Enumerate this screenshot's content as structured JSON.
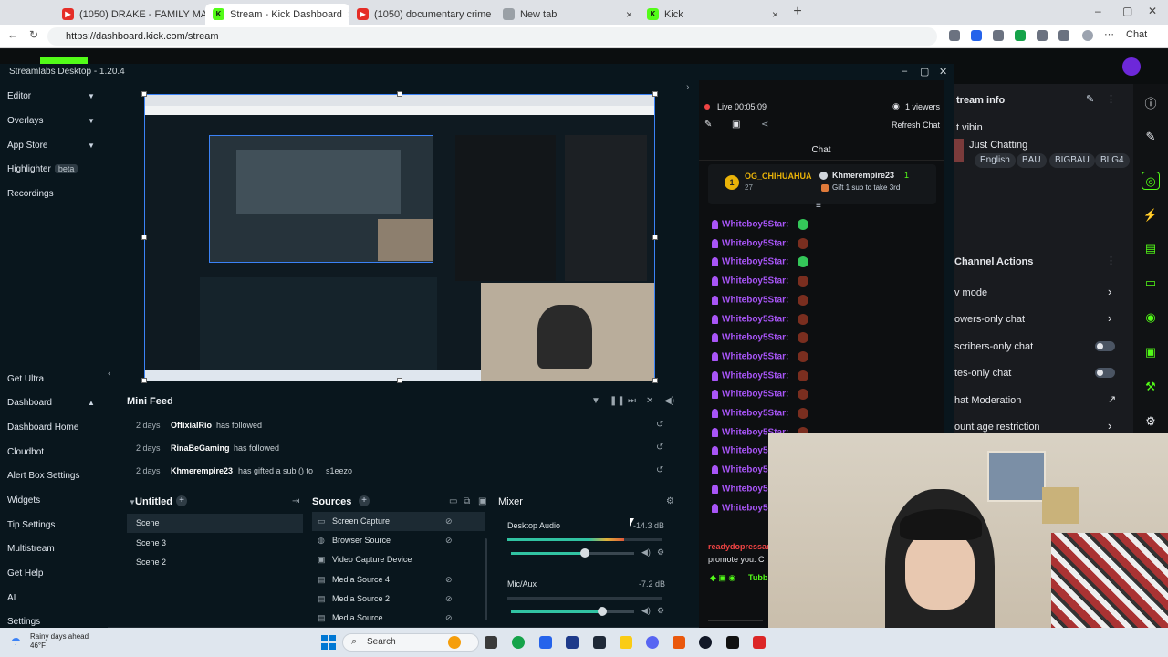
{
  "browser": {
    "tabs": [
      {
        "title": "(1050) DRAKE - FAMILY MATT",
        "icon": "youtube"
      },
      {
        "title": "Stream - Kick Dashboard",
        "icon": "kick"
      },
      {
        "title": "(1050) documentary crime - YouT",
        "icon": "youtube"
      },
      {
        "title": "New tab",
        "icon": "blank"
      },
      {
        "title": "Kick",
        "icon": "kick"
      }
    ],
    "url": "https://dashboard.kick.com/stream",
    "chat_button": "Chat"
  },
  "dashboard": {
    "stream_info_title": "tream info",
    "title_text": "t vibin",
    "category": "Just Chatting",
    "tags": [
      "English",
      "BAU",
      "BIGBAU",
      "BLG4"
    ],
    "channel_actions_title": "Channel Actions",
    "actions": [
      {
        "label": "v mode",
        "control": "chevron"
      },
      {
        "label": "owers-only chat",
        "control": "chevron"
      },
      {
        "label": "scribers-only chat",
        "control": "toggle"
      },
      {
        "label": "tes-only chat",
        "control": "toggle"
      },
      {
        "label": "hat Moderation",
        "control": "link"
      },
      {
        "label": "ount age restriction",
        "control": "chevron"
      }
    ]
  },
  "streamlabs": {
    "window_title": "Streamlabs Desktop - 1.20.4",
    "sidebar_top": [
      {
        "label": "Editor",
        "chevron": true
      },
      {
        "label": "Overlays",
        "chevron": true
      },
      {
        "label": "App Store",
        "chevron": true
      },
      {
        "label": "Highlighter",
        "badge": "beta"
      },
      {
        "label": "Recordings"
      }
    ],
    "sidebar_bottom": [
      {
        "label": "Get Ultra"
      },
      {
        "label": "Dashboard",
        "chevron": true
      },
      {
        "label": "Dashboard Home"
      },
      {
        "label": "Cloudbot"
      },
      {
        "label": "Alert Box Settings"
      },
      {
        "label": "Widgets"
      },
      {
        "label": "Tip Settings"
      },
      {
        "label": "Multistream"
      },
      {
        "label": "Get Help"
      },
      {
        "label": "AI"
      },
      {
        "label": "Settings"
      }
    ],
    "mini_feed": {
      "title": "Mini Feed",
      "rows": [
        {
          "when": "2 days",
          "who": "OffixialRio",
          "what": "has followed"
        },
        {
          "when": "2 days",
          "who": "RinaBeGaming",
          "what": "has followed"
        },
        {
          "when": "2 days",
          "who": "Khmerempire23",
          "what": "has gifted a sub () to",
          "target": "s1eezo"
        }
      ]
    },
    "scenes": {
      "title": "Untitled",
      "items": [
        "Scene",
        "Scene 3",
        "Scene 2"
      ]
    },
    "sources": {
      "title": "Sources",
      "items": [
        "Screen Capture",
        "Browser Source",
        "Video Capture Device",
        "Media Source 4",
        "Media Source 2",
        "Media Source"
      ]
    },
    "mixer": {
      "title": "Mixer",
      "channels": [
        {
          "name": "Desktop Audio",
          "db": "-14.3 dB",
          "level": 0.75,
          "volume": 0.6
        },
        {
          "name": "Mic/Aux",
          "db": "-7.2 dB",
          "level": 0.0,
          "volume": 0.74
        }
      ]
    },
    "stream": {
      "status": "Live 00:05:09",
      "viewers": "1 viewers",
      "refresh": "Refresh Chat",
      "chat_title": "Chat",
      "pinned_top": "OG_CHIHUAHUA",
      "pinned_top_count": "27",
      "pinned_second": "Khmerempire23",
      "pinned_second_count": "1",
      "pinned_gift_note": "Gift 1 sub to take 3rd",
      "chat_user": "Whiteboy5Star:",
      "chat_lines": 16,
      "footer_user": "readydopressan",
      "footer_text": "promote you. C",
      "footer_user2": "Tubb"
    }
  },
  "taskbar": {
    "weather_line1": "Rainy days ahead",
    "weather_line2": "46°F",
    "search": "Search"
  },
  "colors": {
    "kick_green": "#53fc18",
    "accent_teal": "#31c3a2",
    "chat_purple": "#a855f7",
    "live_red": "#ef4444"
  }
}
